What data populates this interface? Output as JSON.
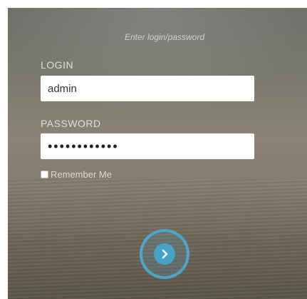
{
  "login_form": {
    "hint": "Enter login/password",
    "login_label": "LOGIN",
    "login_value": "admin",
    "password_label": "PASSWORD",
    "password_value": "admin1234567",
    "remember_label": "Remember Me",
    "remember_checked": false,
    "submit_icon": "chevron-right-icon"
  },
  "colors": {
    "accent": "#50AAD2",
    "input_background": "#FFFFFF"
  }
}
